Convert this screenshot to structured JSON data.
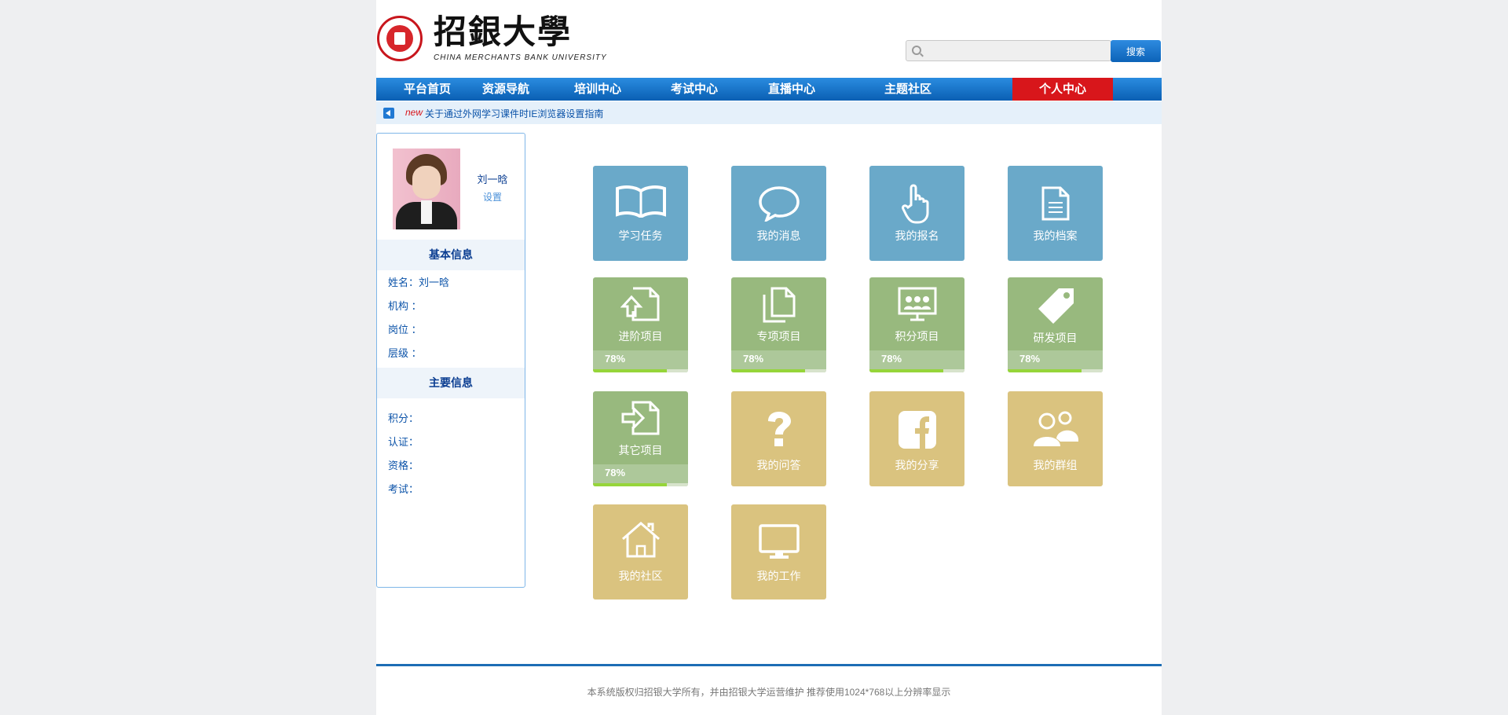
{
  "header": {
    "logo_title": "招銀大學",
    "logo_subtitle": "CHINA MERCHANTS BANK UNIVERSITY",
    "search": {
      "placeholder": "",
      "button_label": "搜索"
    }
  },
  "nav": {
    "items": [
      {
        "label": "平台首页"
      },
      {
        "label": "资源导航"
      },
      {
        "label": "培训中心"
      },
      {
        "label": "考试中心"
      },
      {
        "label": "直播中心"
      },
      {
        "label": "主题社区"
      },
      {
        "label": "个人中心",
        "active": true
      }
    ]
  },
  "notice": {
    "tag": "new",
    "text": "关于通过外网学习课件时IE浏览器设置指南"
  },
  "sidebar": {
    "user_name": "刘一晗",
    "settings_label": "设置",
    "basic_info_title": "基本信息",
    "basic_info": [
      {
        "label": "姓名：",
        "value": "刘一晗"
      },
      {
        "label": "机构 ：",
        "value": ""
      },
      {
        "label": "岗位 ：",
        "value": ""
      },
      {
        "label": "层级 ：",
        "value": ""
      }
    ],
    "main_info_title": "主要信息",
    "main_info": [
      {
        "label": "积分：",
        "value": ""
      },
      {
        "label": "认证：",
        "value": ""
      },
      {
        "label": "资格：",
        "value": ""
      },
      {
        "label": "考试：",
        "value": ""
      }
    ]
  },
  "tiles": [
    {
      "label": "学习任务",
      "icon": "book-icon",
      "color": "#6aa9c9"
    },
    {
      "label": "我的消息",
      "icon": "speech-bubble-icon",
      "color": "#6aa9c9"
    },
    {
      "label": "我的报名",
      "icon": "pointing-hand-icon",
      "color": "#6aa9c9"
    },
    {
      "label": "我的档案",
      "icon": "document-icon",
      "color": "#6aa9c9"
    },
    {
      "label": "进阶项目",
      "icon": "upload-file-icon",
      "color": "#98b97e",
      "progress_text": "78%",
      "progress": 0.78
    },
    {
      "label": "专项项目",
      "icon": "copy-files-icon",
      "color": "#98b97e",
      "progress_text": "78%",
      "progress": 0.78
    },
    {
      "label": "积分项目",
      "icon": "presentation-icon",
      "color": "#98b97e",
      "progress_text": "78%",
      "progress": 0.78
    },
    {
      "label": "研发项目",
      "icon": "tag-icon",
      "color": "#98b97e",
      "progress_text": "78%",
      "progress": 0.78
    },
    {
      "label": "其它项目",
      "icon": "import-file-icon",
      "color": "#98b97e",
      "progress_text": "78%",
      "progress": 0.78
    },
    {
      "label": "我的问答",
      "icon": "question-mark-icon",
      "color": "#dac37f"
    },
    {
      "label": "我的分享",
      "icon": "facebook-icon",
      "color": "#dac37f"
    },
    {
      "label": "我的群组",
      "icon": "group-icon",
      "color": "#dac37f"
    },
    {
      "label": "我的社区",
      "icon": "home-icon",
      "color": "#dac37f"
    },
    {
      "label": "我的工作",
      "icon": "monitor-icon",
      "color": "#dac37f"
    }
  ],
  "footer": {
    "text": "本系统版权归招银大学所有，并由招银大学运营维护  推荐使用1024*768以上分辨率显示"
  }
}
